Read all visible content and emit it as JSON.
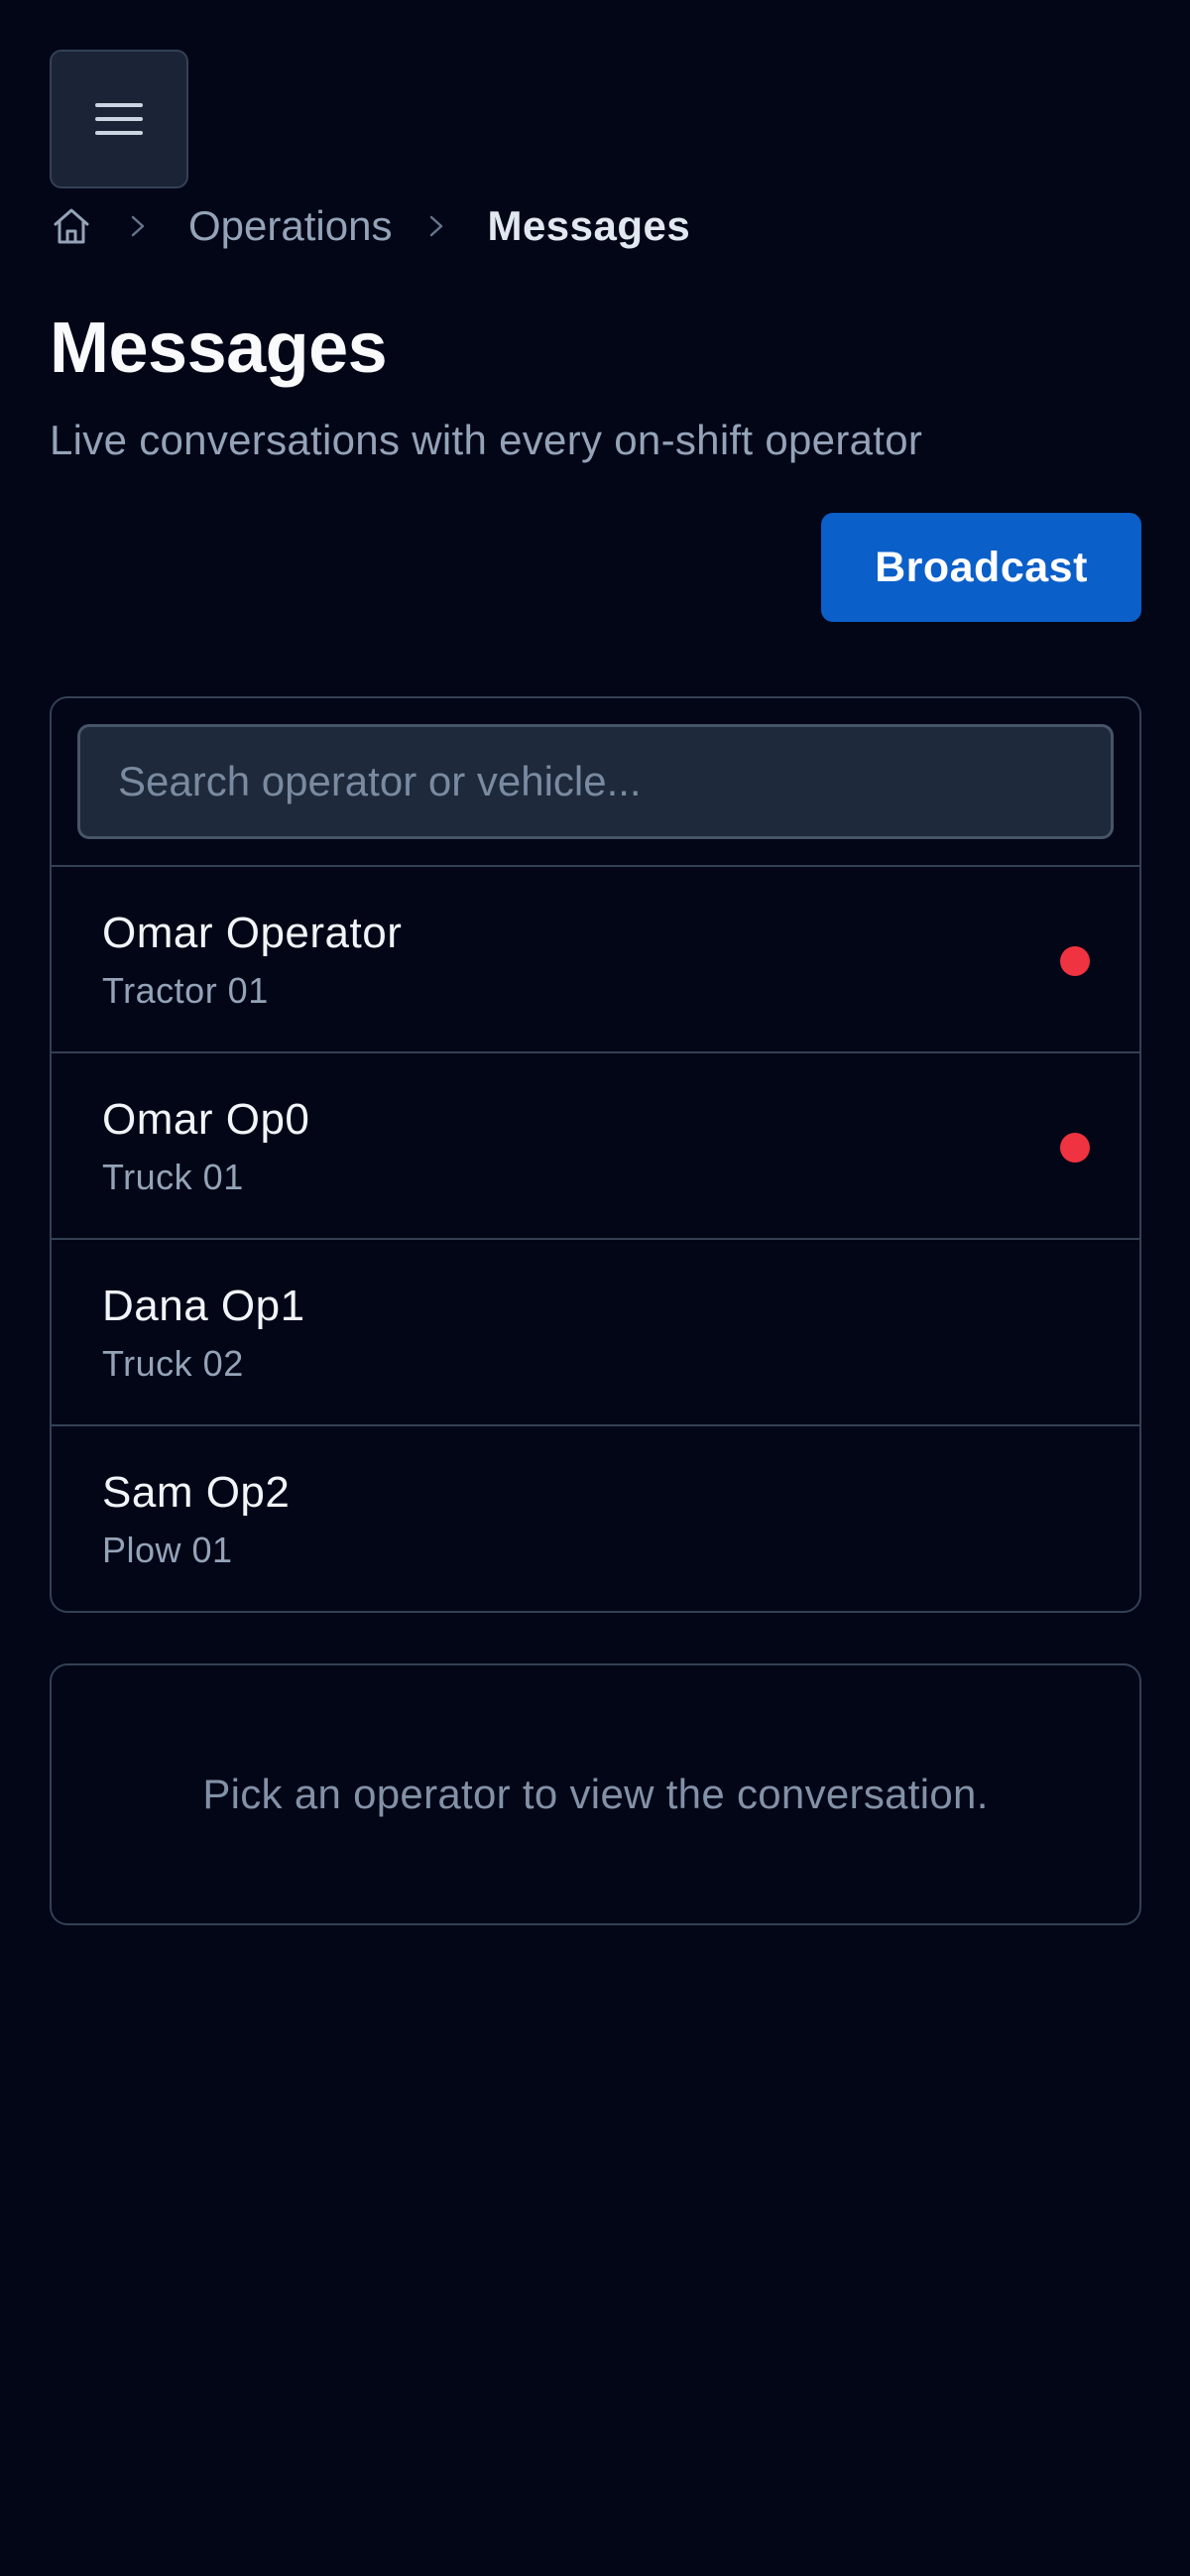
{
  "header": {
    "menu_icon": "hamburger-menu-icon"
  },
  "breadcrumb": {
    "home_icon": "home-icon",
    "separator_icon": "chevron-right-icon",
    "items": [
      "Operations",
      "Messages"
    ]
  },
  "page": {
    "title": "Messages",
    "subtitle": "Live conversations with every on-shift operator"
  },
  "actions": {
    "broadcast_label": "Broadcast"
  },
  "search": {
    "placeholder": "Search operator or vehicle...",
    "value": ""
  },
  "operators": [
    {
      "name": "Omar Operator",
      "vehicle": "Tractor 01",
      "unread": true
    },
    {
      "name": "Omar Op0",
      "vehicle": "Truck 01",
      "unread": true
    },
    {
      "name": "Dana Op1",
      "vehicle": "Truck 02",
      "unread": false
    },
    {
      "name": "Sam Op2",
      "vehicle": "Plow 01",
      "unread": false
    }
  ],
  "conversation": {
    "empty_text": "Pick an operator to view the conversation."
  },
  "colors": {
    "background": "#020617",
    "accent": "#0b5fc9",
    "unread": "#ef3340",
    "border": "#334155"
  }
}
